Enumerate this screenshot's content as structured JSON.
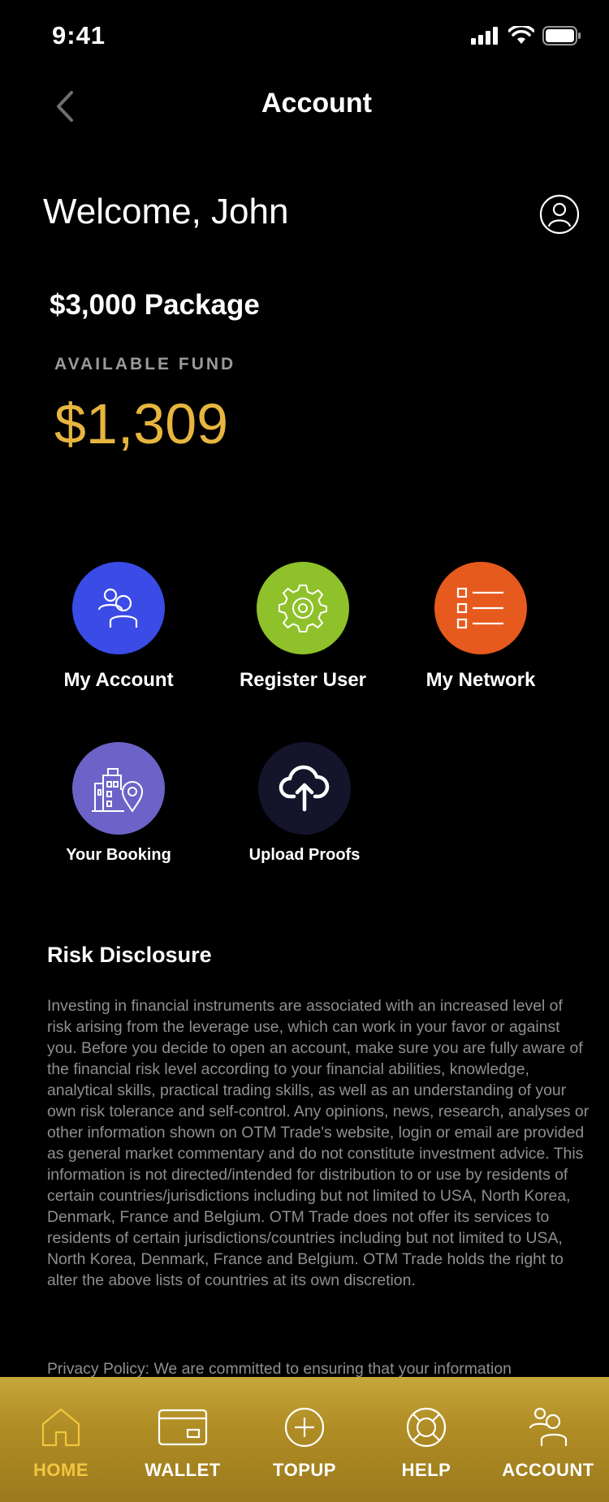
{
  "status": {
    "time": "9:41"
  },
  "nav": {
    "title": "Account"
  },
  "welcome": "Welcome, John",
  "package": {
    "title": "$3,000 Package",
    "fund_label": "AVAILABLE FUND",
    "fund_amount": "$1,309"
  },
  "tiles": [
    {
      "label": "My Account",
      "color": "#3a4be6",
      "icon": "user-group-icon"
    },
    {
      "label": "Register User",
      "color": "#8fc12a",
      "icon": "gear-icon"
    },
    {
      "label": "My Network",
      "color": "#e65a1e",
      "icon": "list-icon"
    },
    {
      "label": "Your Booking",
      "color": "#6c63c9",
      "icon": "building-location-icon"
    },
    {
      "label": "Upload Proofs",
      "color": "#14142a",
      "icon": "cloud-upload-icon"
    }
  ],
  "risk": {
    "title": "Risk Disclosure",
    "text": "Investing in financial instruments are associated with an increased level of risk arising from the leverage use, which can work in your favor or against you. Before you decide to open an account, make sure you are fully aware of the financial risk level according to your financial abilities, knowledge, analytical skills, practical trading skills, as well as an understanding of your own risk tolerance and self-control. Any opinions, news, research, analyses or other information shown on OTM Trade's website, login or email are provided as general market commentary and do not constitute investment advice. This information is not directed/intended for distribution to or use by residents of certain countries/jurisdictions including but not limited to USA, North Korea, Denmark, France and Belgium. OTM Trade does not offer its services to residents of certain jurisdictions/countries including but not limited to USA, North Korea, Denmark, France and Belgium. OTM Trade holds the right to alter the above lists of countries at its own discretion.",
    "privacy": "Privacy Policy: We are committed to ensuring that your information"
  },
  "tabbar": [
    {
      "label": "HOME",
      "icon": "home-icon",
      "active": true
    },
    {
      "label": "WALLET",
      "icon": "wallet-icon",
      "active": false
    },
    {
      "label": "TOPUP",
      "icon": "plus-circle-icon",
      "active": false
    },
    {
      "label": "HELP",
      "icon": "lifebuoy-icon",
      "active": false
    },
    {
      "label": "ACCOUNT",
      "icon": "account-icon",
      "active": false
    }
  ],
  "colors": {
    "accent": "#e7b53f",
    "active_tab": "#f3c640",
    "muted": "#8f8f8f"
  }
}
